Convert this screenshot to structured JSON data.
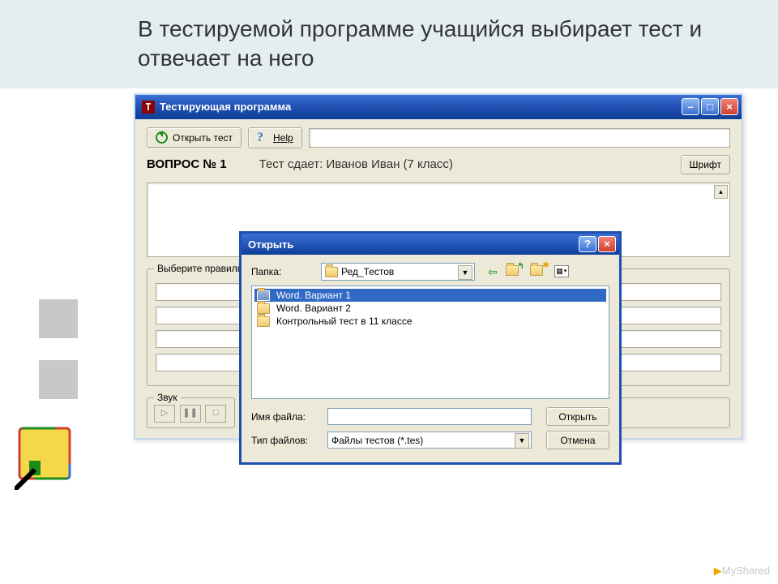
{
  "slide": {
    "title": "В тестируемой программе учащийся выбирает тест и отвечает на него"
  },
  "app": {
    "window_title": "Тестирующая программа",
    "toolbar": {
      "open_test": "Открыть тест",
      "help": "Help"
    },
    "question_label": "ВОПРОС № 1",
    "status_text": "Тест сдает: Иванов Иван (7 класс)",
    "font_button": "Шрифт",
    "answers_group": "Выберите правильный",
    "sound_group": "Звук"
  },
  "dialog": {
    "title": "Открыть",
    "folder_label": "Папка:",
    "current_folder": "Ред_Тестов",
    "files": [
      "Word. Вариант 1",
      "Word. Вариант 2",
      "Контрольный тест в 11 классе"
    ],
    "filename_label": "Имя файла:",
    "filename_value": "",
    "filetype_label": "Тип файлов:",
    "filetype_value": "Файлы тестов (*.tes)",
    "open_button": "Открыть",
    "cancel_button": "Отмена"
  },
  "watermark": {
    "text": "MyShared"
  }
}
